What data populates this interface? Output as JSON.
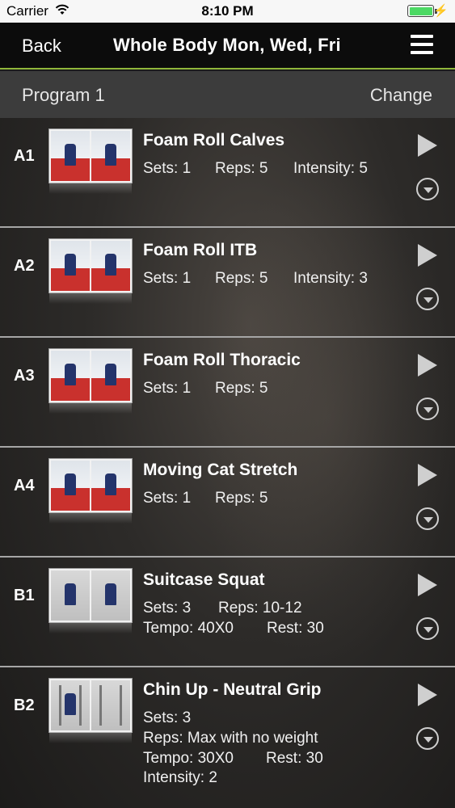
{
  "status_bar": {
    "carrier": "Carrier",
    "time": "8:10 PM"
  },
  "nav": {
    "back_label": "Back",
    "title": "Whole Body Mon, Wed, Fri",
    "menu_icon": "hamburger-menu-icon"
  },
  "program": {
    "label": "Program 1",
    "change_label": "Change"
  },
  "exercises": [
    {
      "code": "A1",
      "name": "Foam Roll Calves",
      "lines": [
        {
          "a": "Sets: 1",
          "b": "Reps: 5",
          "c": "Intensity: 5"
        }
      ]
    },
    {
      "code": "A2",
      "name": "Foam Roll ITB",
      "lines": [
        {
          "a": "Sets: 1",
          "b": "Reps: 5",
          "c": "Intensity: 3"
        }
      ]
    },
    {
      "code": "A3",
      "name": "Foam Roll Thoracic",
      "lines": [
        {
          "a": "Sets: 1",
          "b": "Reps: 5"
        }
      ]
    },
    {
      "code": "A4",
      "name": "Moving Cat Stretch",
      "lines": [
        {
          "a": "Sets: 1",
          "b": "Reps: 5"
        }
      ]
    },
    {
      "code": "B1",
      "name": "Suitcase Squat",
      "lines": [
        {
          "a": "Sets: 3",
          "b": "Reps: 10-12"
        },
        {
          "a": "Tempo: 40X0",
          "b": "Rest: 30"
        }
      ]
    },
    {
      "code": "B2",
      "name": "Chin Up - Neutral Grip",
      "lines": [
        {
          "a": "Sets: 3"
        },
        {
          "a": "Reps: Max with no weight"
        },
        {
          "a": "Tempo: 30X0",
          "b": "Rest: 30"
        },
        {
          "a": "Intensity: 2"
        }
      ]
    }
  ]
}
